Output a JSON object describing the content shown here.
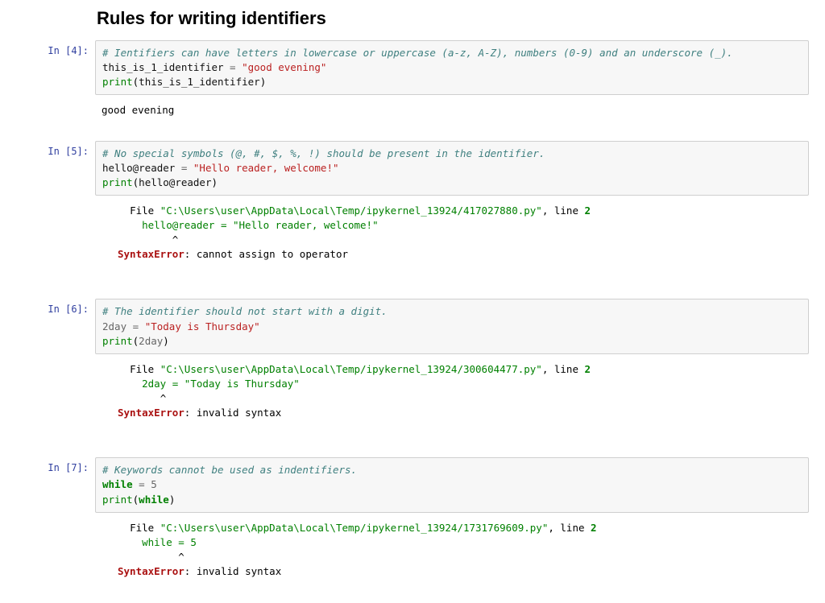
{
  "title": "Rules for writing identifiers",
  "prompts": {
    "in": "In",
    "bracket_open": "[",
    "bracket_close": "]:"
  },
  "cells": [
    {
      "exec_count": "4",
      "code": {
        "comment": "# Ientifiers can have letters in lowercase or uppercase (a-z, A-Z), numbers (0-9) and an underscore (_).",
        "line1_lhs": "this_is_1_identifier",
        "line1_eq": " = ",
        "line1_rhs": "\"good evening\"",
        "line2_print": "print",
        "line2_open": "(",
        "line2_arg": "this_is_1_identifier",
        "line2_close": ")"
      },
      "stdout": "good evening"
    },
    {
      "exec_count": "5",
      "code": {
        "comment": "# No special symbols (@, #, $, %, !) should be present in the identifier.",
        "line1_lhs": "hello@reader",
        "line1_eq": " = ",
        "line1_rhs": "\"Hello reader, welcome!\"",
        "line2_print": "print",
        "line2_open": "(",
        "line2_arg": "hello@reader",
        "line2_close": ")"
      },
      "err": {
        "file_prefix": "  File ",
        "file_path": "\"C:\\Users\\user\\AppData\\Local\\Temp/ipykernel_13924/417027880.py\"",
        "line_sep": ", line ",
        "line_no": "2",
        "echo": "    hello@reader = \"Hello reader, welcome!\"",
        "caret": "         ^",
        "name": "SyntaxError",
        "colon": ": ",
        "msg": "cannot assign to operator"
      }
    },
    {
      "exec_count": "6",
      "code": {
        "comment": "# The identifier should not start with a digit.",
        "line1_lhs": "2day",
        "line1_eq": " = ",
        "line1_rhs": "\"Today is Thursday\"",
        "line2_print": "print",
        "line2_open": "(",
        "line2_arg": "2day",
        "line2_close": ")"
      },
      "err": {
        "file_prefix": "  File ",
        "file_path": "\"C:\\Users\\user\\AppData\\Local\\Temp/ipykernel_13924/300604477.py\"",
        "line_sep": ", line ",
        "line_no": "2",
        "echo": "    2day = \"Today is Thursday\"",
        "caret": "       ^",
        "name": "SyntaxError",
        "colon": ": ",
        "msg": "invalid syntax"
      }
    },
    {
      "exec_count": "7",
      "code": {
        "comment": "# Keywords cannot be used as indentifiers.",
        "line1_lhs": "while",
        "line1_eq": " = ",
        "line1_rhs": "5",
        "line2_print": "print",
        "line2_open": "(",
        "line2_arg": "while",
        "line2_close": ")"
      },
      "err": {
        "file_prefix": "  File ",
        "file_path": "\"C:\\Users\\user\\AppData\\Local\\Temp/ipykernel_13924/1731769609.py\"",
        "line_sep": ", line ",
        "line_no": "2",
        "echo": "    while = 5",
        "caret": "          ^",
        "name": "SyntaxError",
        "colon": ": ",
        "msg": "invalid syntax"
      }
    }
  ]
}
